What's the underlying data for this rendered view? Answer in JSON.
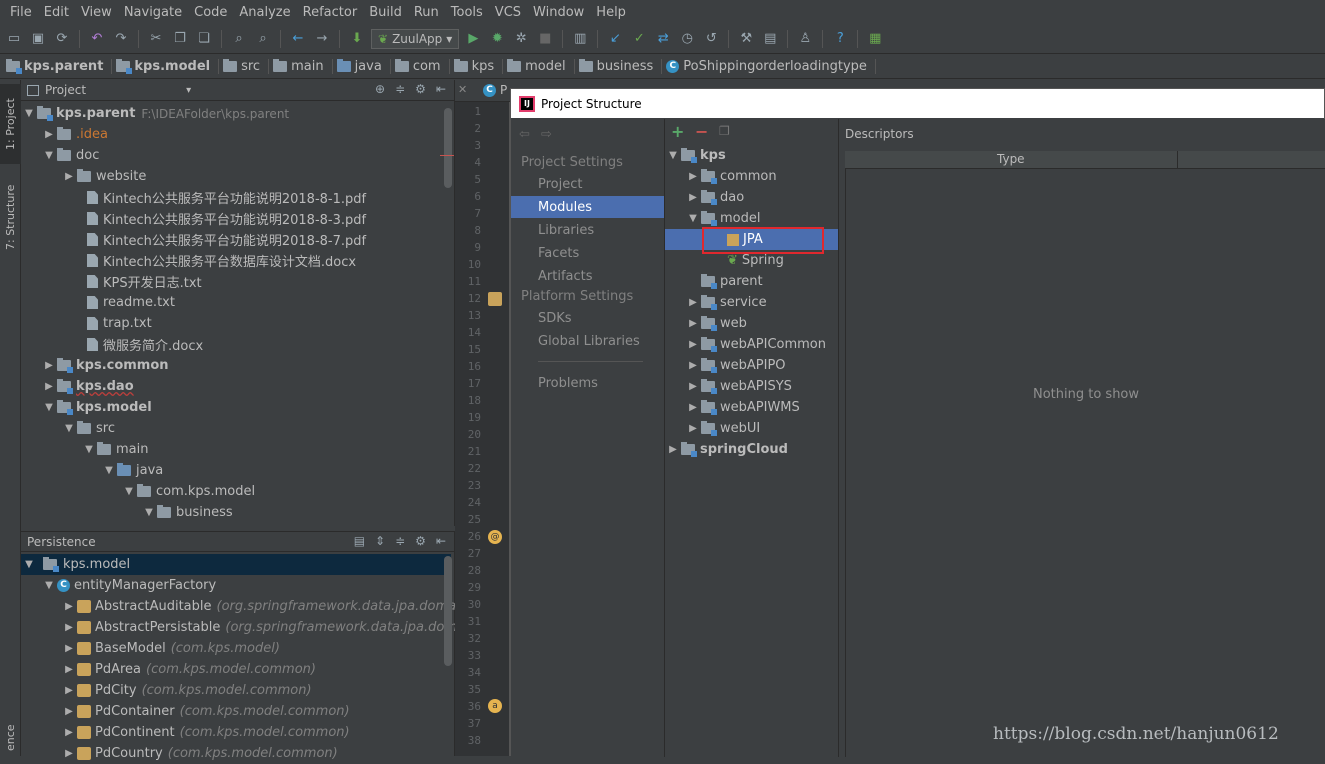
{
  "menu": [
    "File",
    "Edit",
    "View",
    "Navigate",
    "Code",
    "Analyze",
    "Refactor",
    "Build",
    "Run",
    "Tools",
    "VCS",
    "Window",
    "Help"
  ],
  "toolbar": {
    "run_config": "ZuulApp"
  },
  "breadcrumb": [
    "kps.parent",
    "kps.model",
    "src",
    "main",
    "java",
    "com",
    "kps",
    "model",
    "business",
    "PoShippingorderloadingtype"
  ],
  "left_stripe": {
    "project_tab": "1: Project",
    "structure_tab": "7: Structure",
    "persistence_tab": "ence"
  },
  "project_panel": {
    "title": "Project",
    "root_name": "kps.parent",
    "root_path": "F:\\IDEAFolder\\kps.parent",
    "items": [
      ".idea",
      "doc",
      "website",
      "Kintech公共服务平台功能说明2018-8-1.pdf",
      "Kintech公共服务平台功能说明2018-8-3.pdf",
      "Kintech公共服务平台功能说明2018-8-7.pdf",
      "Kintech公共服务平台数据库设计文档.docx",
      "KPS开发日志.txt",
      "readme.txt",
      "trap.txt",
      "微服务简介.docx",
      "kps.common",
      "kps.dao",
      "kps.model",
      "src",
      "main",
      "java",
      "com.kps.model",
      "business"
    ]
  },
  "persistence_panel": {
    "title": "Persistence",
    "root": "kps.model",
    "factory": "entityManagerFactory",
    "entities": [
      {
        "name": "AbstractAuditable",
        "pkg": "(org.springframework.data.jpa.domain)"
      },
      {
        "name": "AbstractPersistable",
        "pkg": "(org.springframework.data.jpa.domain)"
      },
      {
        "name": "BaseModel",
        "pkg": "(com.kps.model)"
      },
      {
        "name": "PdArea",
        "pkg": "(com.kps.model.common)"
      },
      {
        "name": "PdCity",
        "pkg": "(com.kps.model.common)"
      },
      {
        "name": "PdContainer",
        "pkg": "(com.kps.model.common)"
      },
      {
        "name": "PdContinent",
        "pkg": "(com.kps.model.common)"
      },
      {
        "name": "PdCountry",
        "pkg": "(com.kps.model.common)"
      }
    ]
  },
  "editor": {
    "tab_initial": "P",
    "line_numbers": [
      "1",
      "2",
      "3",
      "4",
      "5",
      "6",
      "7",
      "8",
      "9",
      "10",
      "11",
      "12",
      "13",
      "14",
      "15",
      "16",
      "17",
      "18",
      "19",
      "20",
      "21",
      "22",
      "23",
      "24",
      "25",
      "26",
      "27",
      "28",
      "29",
      "30",
      "31",
      "32",
      "33",
      "34",
      "35",
      "36",
      "37",
      "38"
    ]
  },
  "dialog": {
    "title": "Project Structure",
    "project_settings_header": "Project Settings",
    "project_settings": [
      "Project",
      "Modules",
      "Libraries",
      "Facets",
      "Artifacts"
    ],
    "platform_settings_header": "Platform Settings",
    "platform_settings": [
      "SDKs",
      "Global Libraries"
    ],
    "problems": "Problems",
    "selected_nav": "Modules",
    "module_tree": {
      "root": "kps",
      "children": [
        "common",
        "dao",
        "model",
        "JPA",
        "Spring",
        "parent",
        "service",
        "web",
        "webAPICommon",
        "webAPIPO",
        "webAPISYS",
        "webAPIWMS",
        "webUI"
      ],
      "second_root": "springCloud"
    },
    "descriptors_label": "Descriptors",
    "type_column": "Type",
    "empty_text": "Nothing to show"
  },
  "watermark": "https://blog.csdn.net/hanjun0612",
  "colors": {
    "selection": "#4b6eaf",
    "highlight_box": "#e0282e",
    "background": "#3c3f41"
  }
}
